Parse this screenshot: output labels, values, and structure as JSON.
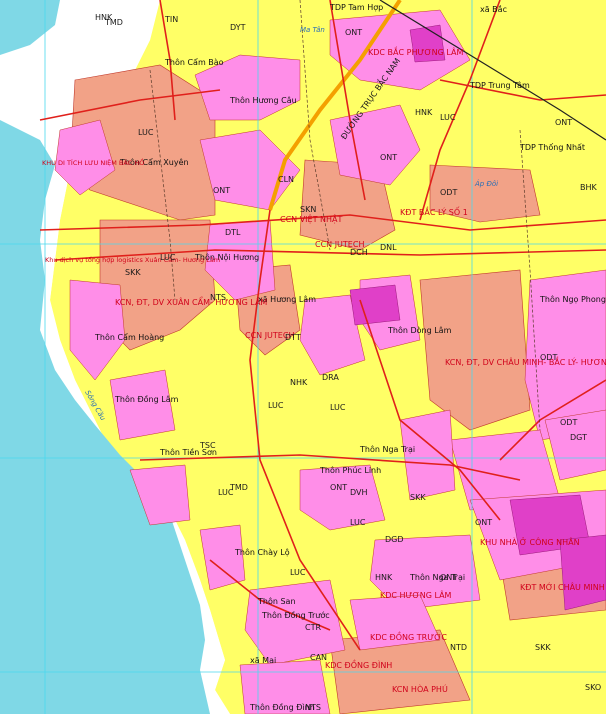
{
  "colors": {
    "river": "#7fd8e6",
    "agri": "#ffff66",
    "industrial": "#f2a287",
    "urban": "#ff8ee8",
    "commune_center": "#e040c8",
    "road": "#e0201b",
    "grid": "#4ad8ee",
    "boundary": "#5a3a2a",
    "highway": "#f4a000"
  },
  "labels": {
    "place_xa_huong_lam": "xã Hương Lâm",
    "place_xa_bac": "xã Bắc",
    "place_tdp_tam_hop": "TDP Tam Hợp",
    "place_tdp_trung_tam": "TDP Trung Tâm",
    "place_tdp_thong_nhat": "TDP Thống Nhất",
    "place_thon_cam_bao": "Thôn Cẩm Bào",
    "place_thon_huong_cau": "Thôn Hương Câu",
    "place_thon_cam_xuyen": "Thôn Cẩm Xuyên",
    "place_thon_noi_huong": "Thôn Nội Hương",
    "place_thon_cam_hoang": "Thôn Cẩm Hoàng",
    "place_thon_dong_lam": "Thôn Đồng Lâm",
    "place_thon_ngo_phong": "Thôn Ngọ Phong",
    "place_thon_nga_trai": "Thôn Nga Trại",
    "place_thon_phuc_linh": "Thôn Phúc Linh",
    "place_thon_tien_son": "Thôn Tiền Sơn",
    "place_thon_chay_lo": "Thôn Chày Lộ",
    "place_thon_san": "Thôn San",
    "place_thon_dong_truoc": "Thôn Đồng Trước",
    "place_xa_mai": "xã Mai",
    "place_thon_nga_trai_2": "Thôn Nga Trại",
    "place_thon_dong_dinh": "Thôn Đồng Đình",
    "place_thon_huong_lam_2": "Thôn Dòng Lâm",
    "zone_kdc_bac_phuong_lam": "KDC BẮC PHƯƠNG LÂM",
    "zone_kcn_jutech": "CCN JUTECH",
    "zone_ccn_jutech_2": "CCN JUTECH",
    "zone_ccn_viet_nhat": "CCN VIỆT NHẬT",
    "zone_kdt_bac_ly": "KĐT BẮC LÝ SỐ 1",
    "zone_kcn_xuan_cam": "KCN, ĐT, DV XUÂN CẨM- HƯƠNG LÂM",
    "zone_kcn_chau_minh": "KCN, ĐT, DV CHÂU MINH- BẮC LÝ- HƯƠNG LÂM",
    "zone_kdt_chau_minh": "KĐT MỚI CHÂU MINH - MAI ĐÌNH",
    "zone_khu_nha_o": "KHU NHÀ Ở CÔNG NHÂN",
    "zone_kdc_huong_lam": "KDC HƯƠNG LÂM",
    "zone_kdc_dong_truoc": "KDC ĐỒNG TRƯỚC",
    "zone_kcn_hoa_phu": "KCN HÒA PHÚ",
    "zone_kdc_dong_dinh": "KDC ĐỒNG ĐÌNH",
    "zone_dich_vu_logistics": "Khu dịch vụ tổng hợp logistics Xuân Cẩm- Hương Lâm",
    "zone_khu_luu_niem": "KHU DI TÍCH LƯU NIỆM BÁC HỒ",
    "road_duong_truc": "ĐƯỜNG TRỤC BẮC NAM",
    "road_ma_tan": "Ma Tân",
    "road_ap_doi": "Áp Đôi",
    "river_song_cau": "Sông Cầu",
    "land_luc": "LUC",
    "land_ont": "ONT",
    "land_odt": "ODT",
    "land_skk": "SKK",
    "land_skn": "SKN",
    "land_tmd": "TMD",
    "land_nts": "NTS",
    "land_dgd": "DGD",
    "land_dvh": "DVH",
    "land_hnk": "HNK",
    "land_bhk": "BHK",
    "land_nhk": "NHK",
    "land_dgt": "DGT",
    "land_dnl": "DNL",
    "land_dtt": "DTT",
    "land_dch": "DCH",
    "land_dtl": "DTL",
    "land_can": "CAN",
    "land_tin": "TIN",
    "land_cln": "CLN",
    "land_dra": "DRA",
    "land_ntd": "NTD",
    "land_dyt": "DYT",
    "land_sko": "SKO",
    "land_ctr": "CTR",
    "land_tsc": "TSC"
  }
}
